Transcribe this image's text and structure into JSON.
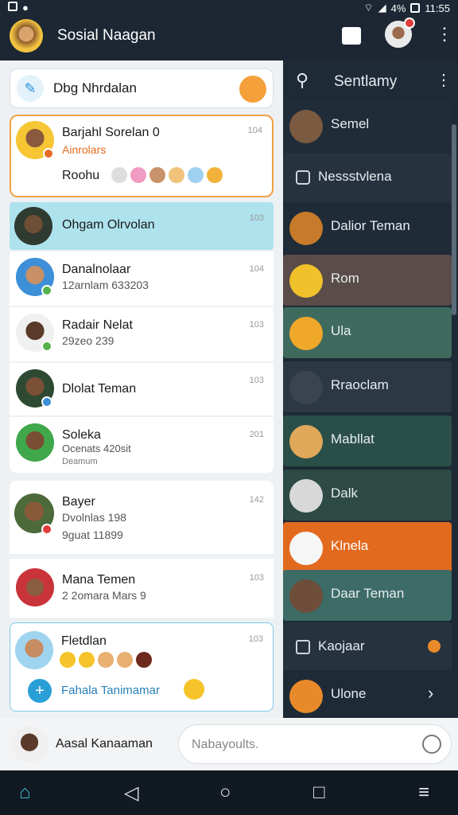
{
  "status": {
    "time": "11:55",
    "battery": "4%"
  },
  "app": {
    "title": "Sosial Naagan"
  },
  "search": {
    "text": "Dbg Nhrdalan"
  },
  "chats": [
    {
      "name": "Barjahl Sorelan 0",
      "sub": "Ainrolars",
      "sub2": "Roohu",
      "time": "104"
    },
    {
      "name": "Ohgam Olrvolan",
      "time": "103"
    },
    {
      "name": "Danalnolaar",
      "sub": "12arnlam 633203",
      "time": "104"
    },
    {
      "name": "Radair Nelat",
      "sub": "29zeo 239",
      "time": "103"
    },
    {
      "name": "Dlolat Teman",
      "time": "103"
    },
    {
      "name": "Soleka",
      "sub": "Ocenats 420sit",
      "sub2": "Deamum",
      "time": "201"
    },
    {
      "name": "Bayer",
      "sub": "Dvolnlas 198",
      "sub2": "9guat 11899",
      "time": "142"
    },
    {
      "name": "Mana Temen",
      "sub": "2 2omara Mars 9",
      "time": "103"
    },
    {
      "name": "Fletdlan",
      "time": "103",
      "action": "Fahala Tanimamar"
    }
  ],
  "right_header": {
    "title": "Sentlamy"
  },
  "right_items": [
    {
      "label": "Semel"
    },
    {
      "label": "Nessstvlena"
    },
    {
      "label": "Dalior Teman"
    },
    {
      "label": "Rom"
    },
    {
      "label": "Ula"
    },
    {
      "label": "Rraoclam"
    },
    {
      "label": "Mabllat"
    },
    {
      "label": "Dalk"
    },
    {
      "label": "Klnela"
    },
    {
      "label": "Daar Teman"
    },
    {
      "label": "Kaojaar"
    },
    {
      "label": "Ulone"
    }
  ],
  "footer": {
    "name": "Aasal Kanaaman",
    "placeholder": "Nabayoults."
  },
  "colors": {
    "accent_orange": "#e26a1e",
    "highlight_blue": "#aee3ee",
    "teal": "#3d6b66"
  }
}
